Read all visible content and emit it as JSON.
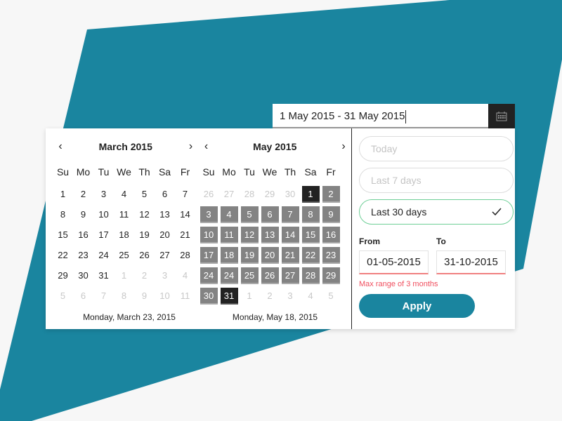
{
  "colors": {
    "accent": "#1a859f",
    "selected": "#222222",
    "in_range": "#838383",
    "success": "#6fcf97",
    "error": "#f04e5e",
    "background": "#f7f7f7"
  },
  "range_input": {
    "value": "1 May 2015 - 31 May 2015",
    "icon": "calendar-icon"
  },
  "weekdays": [
    "Su",
    "Mo",
    "Tu",
    "We",
    "Th",
    "Sa",
    "Fr"
  ],
  "calendars": [
    {
      "title": "March 2015",
      "prev_icon": "chevron-left-icon",
      "next_icon": "chevron-right-icon",
      "days": [
        {
          "d": "1",
          "s": ""
        },
        {
          "d": "2",
          "s": ""
        },
        {
          "d": "3",
          "s": ""
        },
        {
          "d": "4",
          "s": ""
        },
        {
          "d": "5",
          "s": ""
        },
        {
          "d": "6",
          "s": ""
        },
        {
          "d": "7",
          "s": ""
        },
        {
          "d": "8",
          "s": ""
        },
        {
          "d": "9",
          "s": ""
        },
        {
          "d": "10",
          "s": ""
        },
        {
          "d": "11",
          "s": ""
        },
        {
          "d": "12",
          "s": ""
        },
        {
          "d": "13",
          "s": ""
        },
        {
          "d": "14",
          "s": ""
        },
        {
          "d": "15",
          "s": ""
        },
        {
          "d": "16",
          "s": ""
        },
        {
          "d": "17",
          "s": ""
        },
        {
          "d": "18",
          "s": ""
        },
        {
          "d": "19",
          "s": ""
        },
        {
          "d": "20",
          "s": ""
        },
        {
          "d": "21",
          "s": ""
        },
        {
          "d": "22",
          "s": ""
        },
        {
          "d": "23",
          "s": ""
        },
        {
          "d": "24",
          "s": ""
        },
        {
          "d": "25",
          "s": ""
        },
        {
          "d": "26",
          "s": ""
        },
        {
          "d": "27",
          "s": ""
        },
        {
          "d": "28",
          "s": ""
        },
        {
          "d": "29",
          "s": ""
        },
        {
          "d": "30",
          "s": ""
        },
        {
          "d": "31",
          "s": ""
        },
        {
          "d": "1",
          "s": "other"
        },
        {
          "d": "2",
          "s": "other"
        },
        {
          "d": "3",
          "s": "other"
        },
        {
          "d": "4",
          "s": "other"
        },
        {
          "d": "5",
          "s": "other"
        },
        {
          "d": "6",
          "s": "other"
        },
        {
          "d": "7",
          "s": "other"
        },
        {
          "d": "8",
          "s": "other"
        },
        {
          "d": "9",
          "s": "other"
        },
        {
          "d": "10",
          "s": "other"
        },
        {
          "d": "11",
          "s": "other"
        }
      ],
      "footer": "Monday, March 23, 2015"
    },
    {
      "title": "May 2015",
      "prev_icon": "chevron-left-icon",
      "next_icon": "chevron-right-icon",
      "days": [
        {
          "d": "26",
          "s": "other"
        },
        {
          "d": "27",
          "s": "other"
        },
        {
          "d": "28",
          "s": "other"
        },
        {
          "d": "29",
          "s": "other"
        },
        {
          "d": "30",
          "s": "other"
        },
        {
          "d": "1",
          "s": "selected"
        },
        {
          "d": "2",
          "s": "inrange"
        },
        {
          "d": "3",
          "s": "inrange"
        },
        {
          "d": "4",
          "s": "inrange"
        },
        {
          "d": "5",
          "s": "inrange"
        },
        {
          "d": "6",
          "s": "inrange"
        },
        {
          "d": "7",
          "s": "inrange"
        },
        {
          "d": "8",
          "s": "inrange"
        },
        {
          "d": "9",
          "s": "inrange"
        },
        {
          "d": "10",
          "s": "inrange"
        },
        {
          "d": "11",
          "s": "inrange"
        },
        {
          "d": "12",
          "s": "inrange"
        },
        {
          "d": "13",
          "s": "inrange"
        },
        {
          "d": "14",
          "s": "inrange"
        },
        {
          "d": "15",
          "s": "inrange"
        },
        {
          "d": "16",
          "s": "inrange"
        },
        {
          "d": "17",
          "s": "inrange"
        },
        {
          "d": "18",
          "s": "inrange"
        },
        {
          "d": "19",
          "s": "inrange"
        },
        {
          "d": "20",
          "s": "inrange"
        },
        {
          "d": "21",
          "s": "inrange"
        },
        {
          "d": "22",
          "s": "inrange"
        },
        {
          "d": "23",
          "s": "inrange"
        },
        {
          "d": "24",
          "s": "inrange"
        },
        {
          "d": "24",
          "s": "inrange"
        },
        {
          "d": "25",
          "s": "inrange"
        },
        {
          "d": "26",
          "s": "inrange"
        },
        {
          "d": "27",
          "s": "inrange"
        },
        {
          "d": "28",
          "s": "inrange"
        },
        {
          "d": "29",
          "s": "inrange"
        },
        {
          "d": "30",
          "s": "inrange"
        },
        {
          "d": "31",
          "s": "selected"
        },
        {
          "d": "1",
          "s": "other"
        },
        {
          "d": "2",
          "s": "other"
        },
        {
          "d": "3",
          "s": "other"
        },
        {
          "d": "4",
          "s": "other"
        },
        {
          "d": "5",
          "s": "other"
        }
      ],
      "footer": "Monday, May 18, 2015"
    }
  ],
  "presets": [
    {
      "label": "Today",
      "active": false
    },
    {
      "label": "Last 7 days",
      "active": false
    },
    {
      "label": "Last 30 days",
      "active": true,
      "icon": "checkmark-icon"
    }
  ],
  "custom_range": {
    "from_label": "From",
    "to_label": "To",
    "from_value": "01-05-2015",
    "to_value": "31-10-2015",
    "error": "Max range of 3 months",
    "apply_label": "Apply"
  }
}
